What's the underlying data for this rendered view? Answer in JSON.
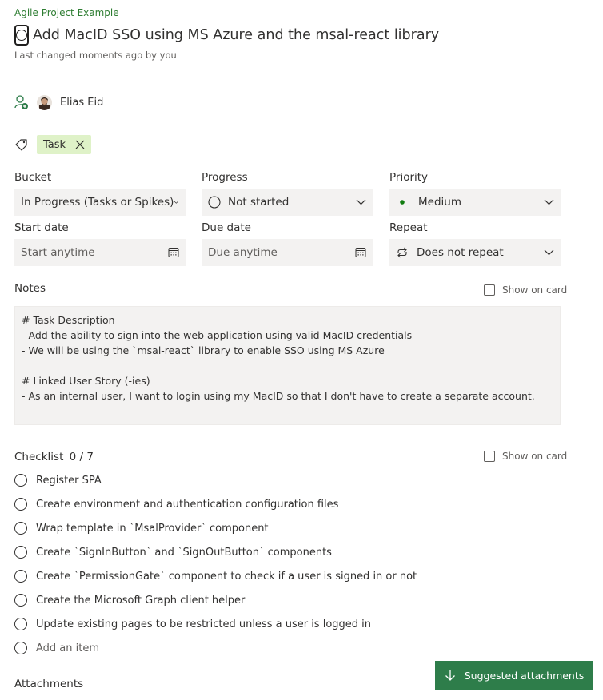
{
  "plan": {
    "name": "Agile Project Example"
  },
  "task": {
    "title": "Add MacID SSO using MS Azure and the msal-react library",
    "last_changed": "Last changed moments ago by you"
  },
  "assignment": {
    "assignee_name": "Elias Eid",
    "icon": "add-person-icon"
  },
  "labels": {
    "icon": "tag-icon",
    "tags": [
      "Task"
    ]
  },
  "fields": {
    "bucket": {
      "label": "Bucket",
      "value": "In Progress (Tasks or Spikes)"
    },
    "progress": {
      "label": "Progress",
      "value": "Not started"
    },
    "priority": {
      "label": "Priority",
      "value": "Medium"
    },
    "start_date": {
      "label": "Start date",
      "placeholder": "Start anytime"
    },
    "due_date": {
      "label": "Due date",
      "placeholder": "Due anytime"
    },
    "repeat": {
      "label": "Repeat",
      "value": "Does not repeat"
    }
  },
  "notes": {
    "label": "Notes",
    "show_on_card": "Show on card",
    "text": "# Task Description\n- Add the ability to sign into the web application using valid MacID credentials\n- We will be using the `msal-react` library to enable SSO using MS Azure\n\n# Linked User Story (-ies)\n- As an internal user, I want to login using my MacID so that I don't have to create a separate account."
  },
  "checklist": {
    "label": "Checklist",
    "count": "0 / 7",
    "show_on_card": "Show on card",
    "items": [
      "Register SPA",
      "Create environment and authentication configuration files",
      "Wrap template in `MsalProvider` component",
      "Create `SignInButton` and `SignOutButton` components",
      "Create `PermissionGate` component to check if a user is signed in or not",
      "Create the Microsoft Graph client helper",
      "Update existing pages to be restricted unless a user is logged in"
    ],
    "add_item": "Add an item"
  },
  "attachments": {
    "label": "Attachments",
    "suggested_button": "Suggested attachments"
  },
  "colors": {
    "brand_green": "#2e7d4a",
    "tag_bg": "#dff2c8",
    "field_bg": "#f3f2f1",
    "priority_dot": "#107c10"
  }
}
